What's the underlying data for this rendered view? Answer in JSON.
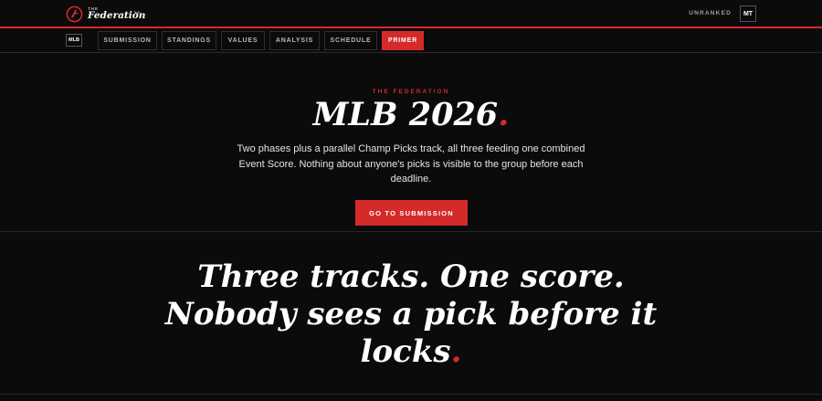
{
  "header": {
    "brand_small": "THE",
    "brand_name": "Federation",
    "rank_label": "UNRANKED",
    "avatar_initials": "MT",
    "accent_color": "#d42a2a"
  },
  "nav": {
    "league_badge": "MLB",
    "tabs": [
      {
        "label": "SUBMISSION",
        "active": false
      },
      {
        "label": "STANDINGS",
        "active": false
      },
      {
        "label": "VALUES",
        "active": false
      },
      {
        "label": "ANALYSIS",
        "active": false
      },
      {
        "label": "SCHEDULE",
        "active": false
      },
      {
        "label": "PRIMER",
        "active": true
      }
    ]
  },
  "hero": {
    "eyebrow": "THE FEDERATION",
    "title": "MLB 2026",
    "title_dot": ".",
    "description": "Two phases plus a parallel Champ Picks track, all three feeding one combined Event Score. Nothing about anyone's picks is visible to the group before each deadline.",
    "cta_label": "GO TO SUBMISSION"
  },
  "statement": {
    "text": "Three tracks. One score. Nobody sees a pick before it locks",
    "dot": "."
  }
}
